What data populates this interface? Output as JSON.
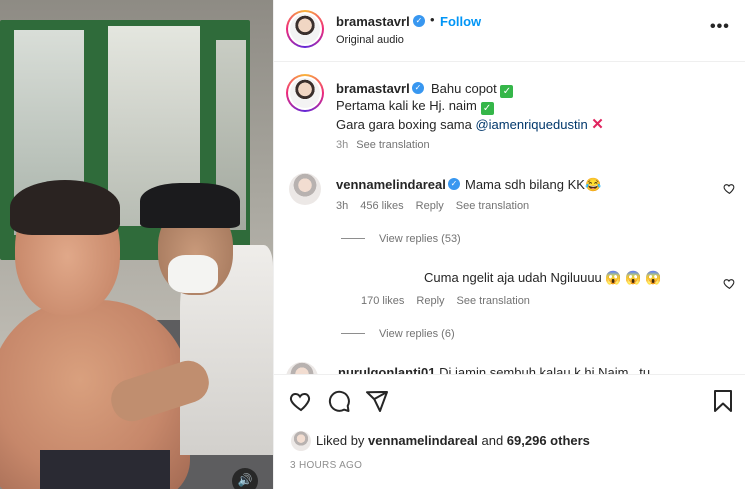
{
  "header": {
    "username": "bramastavrl",
    "separator": "•",
    "follow_label": "Follow",
    "audio": "Original audio",
    "more": "•••"
  },
  "caption": {
    "username": "bramastavrl",
    "line1": "Bahu copot",
    "line2": "Pertama kali ke Hj. naim",
    "line3_prefix": "Gara gara boxing sama ",
    "mention": "@iamenriquedustin",
    "time": "3h",
    "see_translation": "See translation"
  },
  "comments": [
    {
      "username": "vennamelindareal",
      "text": "Mama sdh bilang KK😂",
      "time": "3h",
      "likes": "456 likes",
      "reply": "Reply",
      "see_translation": "See translation",
      "view_replies": "View replies (53)"
    },
    {
      "username": "",
      "text": "Cuma ngelit aja udah Ngiluuuu 😱 😱 😱",
      "time": "",
      "likes": "170 likes",
      "reply": "Reply",
      "see_translation": "See translation",
      "view_replies": "View replies (6)"
    },
    {
      "username": "nurulqonlanti01",
      "text": "Di jamin sembuh kalau k hj Naim...tu"
    }
  ],
  "actions": {
    "liked_prefix": "Liked by ",
    "liked_user": "vennamelindareal",
    "liked_and": " and ",
    "liked_others": "69,296 others",
    "timestamp": "3 HOURS AGO"
  },
  "colors": {
    "follow": "#0095f6",
    "verified": "#3897f0",
    "check": "#35b649",
    "cross": "#e0245e"
  },
  "icons": [
    "sound-icon",
    "verified-icon",
    "more-icon",
    "heart-icon",
    "comment-icon",
    "share-icon",
    "bookmark-icon"
  ]
}
